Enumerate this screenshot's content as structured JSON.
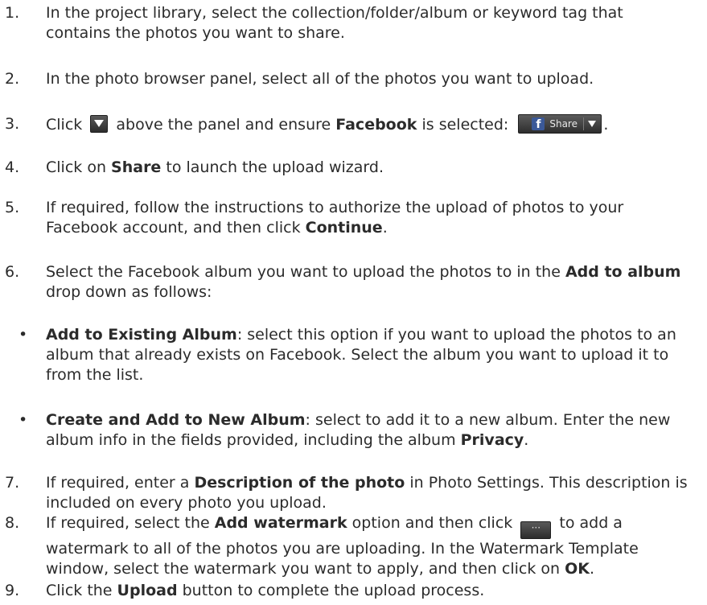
{
  "steps": [
    {
      "num": "1.",
      "a": "In the project library, select the collection/folder/album or keyword tag that contains the photos you want to share."
    },
    {
      "num": "2.",
      "a": "In the photo browser panel, select all of the photos you want to upload."
    },
    {
      "num": "3.",
      "a": "Click",
      "b": "above the panel and ensure",
      "bold1": "Facebook",
      "c": "is selected:",
      "d": ".",
      "share_label": "Share",
      "icons": [
        "dropdown-arrow-icon",
        "facebook-icon"
      ]
    },
    {
      "num": "4.",
      "a": "Click on",
      "bold1": "Share",
      "b": "to launch the upload wizard."
    },
    {
      "num": "5.",
      "a": "If required, follow the instructions to authorize the upload of photos to your Facebook account, and then click",
      "bold1": "Continue",
      "b": "."
    },
    {
      "num": "6.",
      "a": "Select the Facebook album you want to upload the photos to in the",
      "bold1": "Add to album",
      "b": "drop down as follows:"
    },
    {
      "num": "7.",
      "a": "If required, enter a",
      "bold1": "Description of the photo",
      "b": "in Photo Settings. This description is included on every photo you upload."
    },
    {
      "num": "8.",
      "a": "If required, select the",
      "bold1": "Add watermark",
      "b": "option and then click",
      "dots": "···",
      "c": "to add a watermark to all of the photos you are uploading. In the Watermark Template window, select the watermark you want to apply, and then click on",
      "bold2": "OK",
      "d": "."
    },
    {
      "num": "9.",
      "a": "Click the",
      "bold1": "Upload",
      "b": "button to complete the upload process."
    }
  ],
  "bullets": [
    {
      "dot": "•",
      "bold": "Add to Existing Album",
      "text": ": select this option if you want to upload the photos to an album that already exists on Facebook. Select the album you want to upload it to from the list."
    },
    {
      "dot": "•",
      "bold": "Create and Add to New Album",
      "text": ": select to add it to a new album. Enter the new album info in the fields provided, including the album",
      "bold2": "Privacy",
      "end": "."
    }
  ]
}
